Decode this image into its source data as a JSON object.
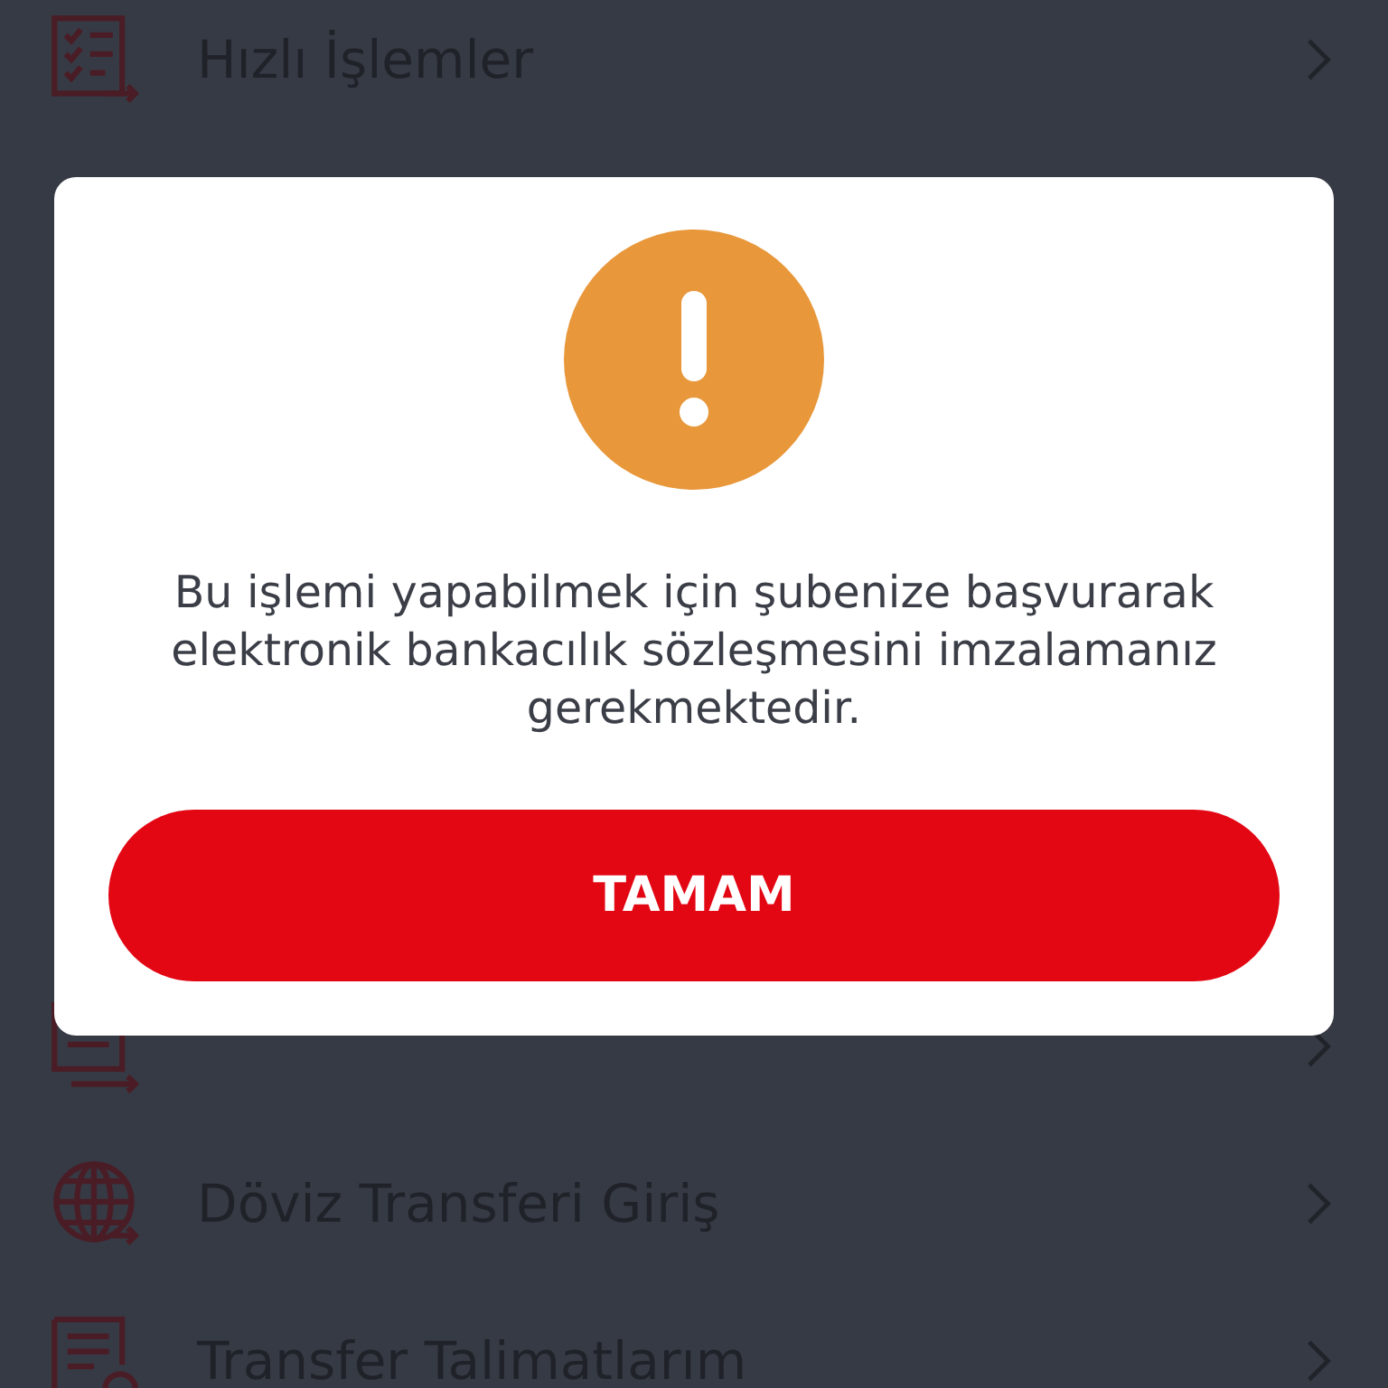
{
  "menu": {
    "items": [
      {
        "label": "Hızlı İşlemler",
        "kind": "checklist"
      },
      {
        "kind": "transfer"
      },
      {
        "label": "Döviz Transferi Giriş",
        "kind": "globe"
      },
      {
        "label": "Transfer Talimatlarım",
        "kind": "document"
      }
    ]
  },
  "dialog": {
    "message": "Bu işlemi yapabilmek için şubenize başvurarak elektronik bankacılık sözleşmesini imzalamanız gerekmektedir.",
    "button": "TAMAM"
  }
}
